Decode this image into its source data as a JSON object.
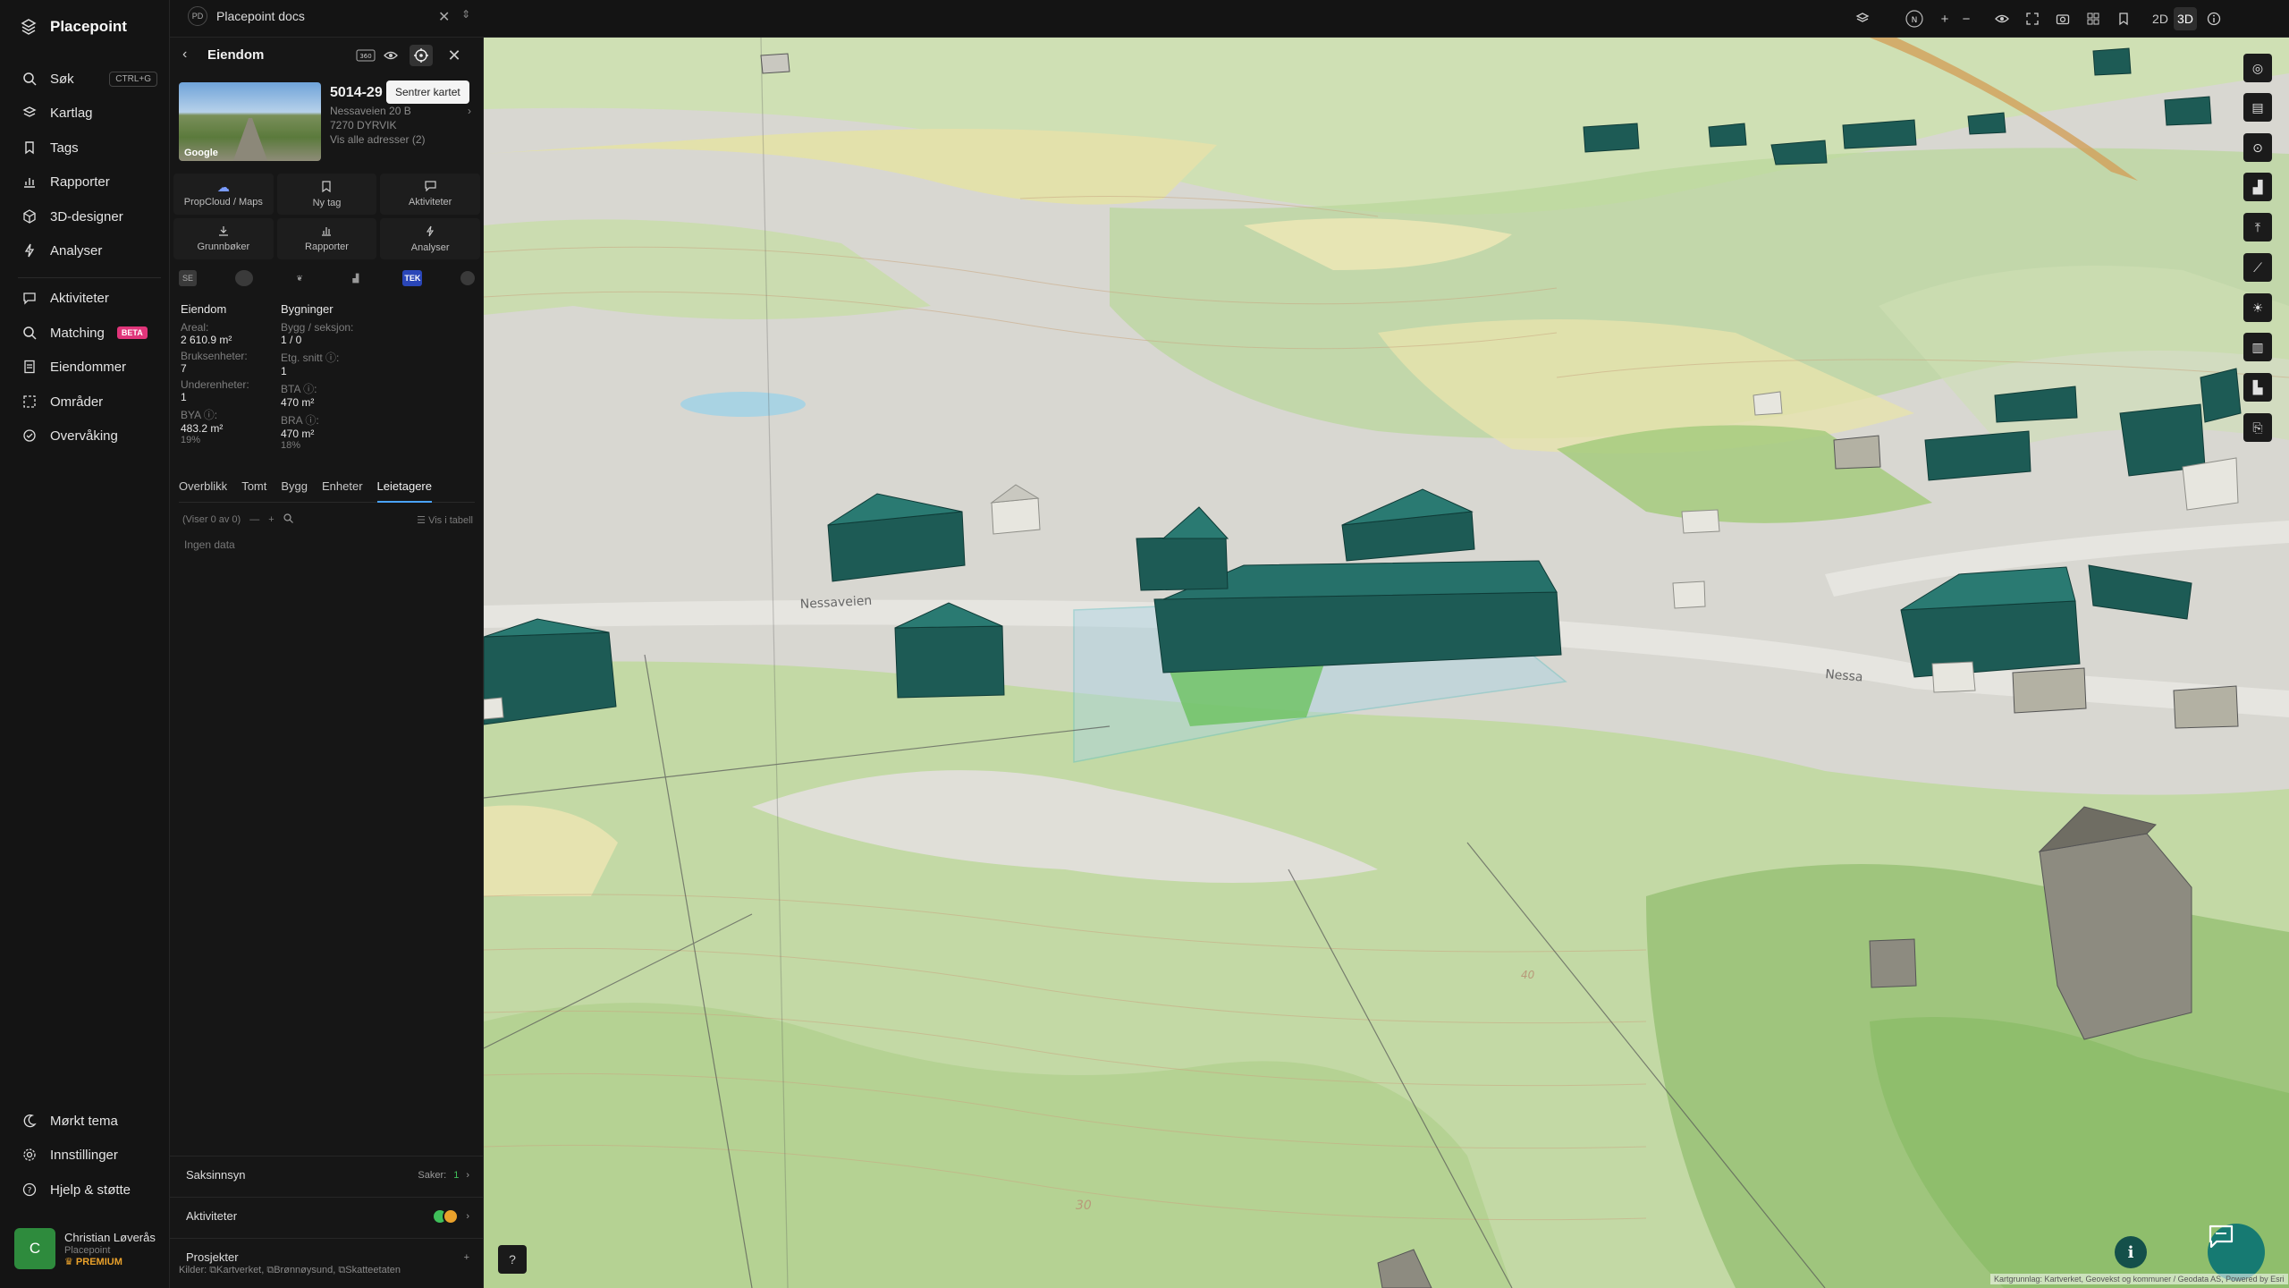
{
  "app": {
    "name": "Placepoint"
  },
  "nav": {
    "items": [
      {
        "label": "Søk",
        "icon": "search-icon",
        "shortcut": "CTRL+G"
      },
      {
        "label": "Kartlag",
        "icon": "layers-icon"
      },
      {
        "label": "Tags",
        "icon": "bookmark-icon"
      },
      {
        "label": "Rapporter",
        "icon": "bar-chart-icon"
      },
      {
        "label": "3D-designer",
        "icon": "cube-icon"
      },
      {
        "label": "Analyser",
        "icon": "bolt-icon"
      },
      {
        "label": "Aktiviteter",
        "icon": "chat-icon"
      },
      {
        "label": "Matching",
        "icon": "search-icon",
        "badge": "BETA"
      },
      {
        "label": "Eiendommer",
        "icon": "document-icon"
      },
      {
        "label": "Områder",
        "icon": "area-icon"
      },
      {
        "label": "Overvåking",
        "icon": "monitor-icon"
      }
    ],
    "bottom": [
      {
        "label": "Mørkt tema",
        "icon": "moon-icon"
      },
      {
        "label": "Innstillinger",
        "icon": "gear-icon"
      },
      {
        "label": "Hjelp & støtte",
        "icon": "help-icon"
      }
    ],
    "user": {
      "initial": "C",
      "name": "Christian Løverås",
      "org": "Placepoint",
      "plan": "PREMIUM"
    }
  },
  "topbar": {
    "docs_badge": "PD",
    "docs_title": "Placepoint docs",
    "view_2d": "2D",
    "view_3d": "3D",
    "compass": "N"
  },
  "panel": {
    "title": "Eiendom",
    "tooltip": "Sentrer kartet",
    "thumb_label": "Google",
    "property": {
      "id": "5014-29",
      "address": "Nessaveien 20 B",
      "postal": "7270 DYRVIK",
      "all_addresses": "Vis alle adresser (2)"
    },
    "actions": [
      {
        "label": "PropCloud / Maps",
        "icon": "cloud-icon"
      },
      {
        "label": "Ny tag",
        "icon": "bookmark-icon"
      },
      {
        "label": "Aktiviteter",
        "icon": "chat-icon"
      },
      {
        "label": "Grunnbøker",
        "icon": "download-icon"
      },
      {
        "label": "Rapporter",
        "icon": "bar-chart-icon"
      },
      {
        "label": "Analyser",
        "icon": "bolt-icon"
      }
    ],
    "layers": [
      {
        "label": "SE"
      },
      {
        "label": ""
      },
      {
        "label": ""
      },
      {
        "label": ""
      },
      {
        "label": "TEK"
      },
      {
        "label": ""
      }
    ],
    "facts": {
      "left_header": "Eiendom",
      "right_header": "Bygninger",
      "left": [
        {
          "label": "Areal:",
          "value": "2 610.9 m²"
        },
        {
          "label": "Bruksenheter:",
          "value": "7"
        },
        {
          "label": "Underenheter:",
          "value": "1"
        },
        {
          "label": "BYA ⓘ:",
          "value": "483.2 m²",
          "sub": "19%"
        }
      ],
      "right": [
        {
          "label": "Bygg / seksjon:",
          "value": "1 / 0"
        },
        {
          "label": "Etg. snitt ⓘ:",
          "value": "1"
        },
        {
          "label": "BTA ⓘ:",
          "value": "470 m²"
        },
        {
          "label": "BRA ⓘ:",
          "value": "470 m²",
          "sub": "18%"
        }
      ]
    },
    "tabs": [
      "Overblikk",
      "Tomt",
      "Bygg",
      "Enheter",
      "Leietagere"
    ],
    "active_tab": "Leietagere",
    "list": {
      "count_text": "(Viser 0 av 0)",
      "view_table": "Vis i tabell",
      "empty": "Ingen data"
    },
    "rows": [
      {
        "label": "Saksinnsyn",
        "right_label": "Saker:",
        "right_value": "1"
      },
      {
        "label": "Aktiviteter"
      },
      {
        "label": "Prosjekter"
      }
    ],
    "sources": {
      "prefix": "Kilder:",
      "items": [
        "Kartverket,",
        "Brønnøysund,",
        "Skatteetaten"
      ]
    }
  },
  "map": {
    "road_label": "Nessaveien",
    "road_label_2": "Nessa",
    "contour_1": "30",
    "contour_2": "40",
    "attribution": "Kartgrunnlag: Kartverket, Geovekst og kommuner / Geodata AS, Powered by Esri",
    "colors": {
      "building": "#1d5b55",
      "field_green": "#a9cc8a",
      "field_yellow": "#e5e2a8",
      "ground": "#d9d8d2",
      "water": "#a9d3e3"
    }
  }
}
